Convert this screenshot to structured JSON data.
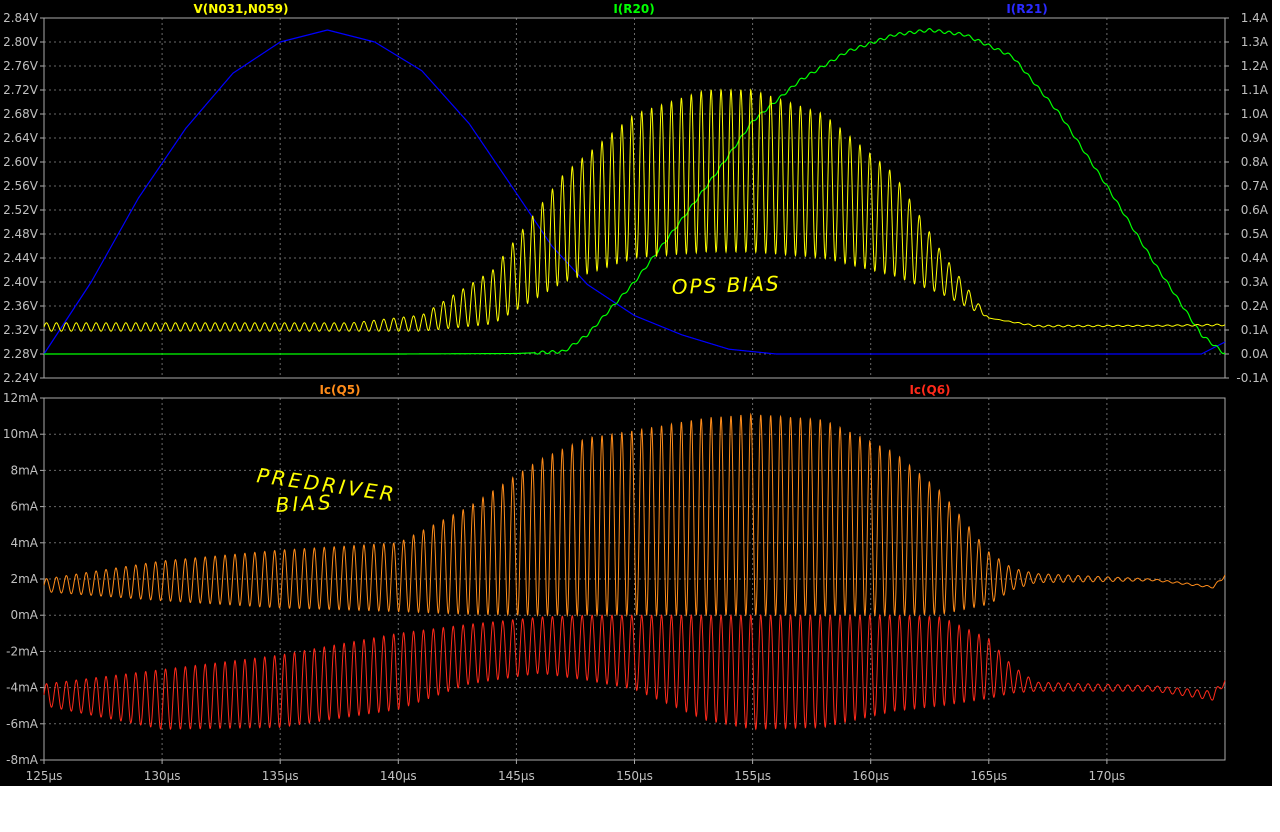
{
  "chart_data": [
    {
      "type": "line",
      "panel": "top",
      "x_unit": "µs",
      "xlim": [
        125,
        175
      ],
      "x_ticks": [
        "125µs",
        "130µs",
        "135µs",
        "140µs",
        "145µs",
        "150µs",
        "155µs",
        "160µs",
        "165µs",
        "170µs"
      ],
      "ylim_left": [
        2.24,
        2.84
      ],
      "left_ticks": [
        "2.84V",
        "2.80V",
        "2.76V",
        "2.72V",
        "2.68V",
        "2.64V",
        "2.60V",
        "2.56V",
        "2.52V",
        "2.48V",
        "2.44V",
        "2.40V",
        "2.36V",
        "2.32V",
        "2.28V",
        "2.24V"
      ],
      "ylim_right": [
        -0.1,
        1.4
      ],
      "right_ticks": [
        "1.4A",
        "1.3A",
        "1.2A",
        "1.1A",
        "1.0A",
        "0.9A",
        "0.8A",
        "0.7A",
        "0.6A",
        "0.5A",
        "0.4A",
        "0.3A",
        "0.2A",
        "0.1A",
        "0.0A",
        "-0.1A"
      ],
      "grid": true,
      "series": [
        {
          "name": "V(N031,N059)",
          "axis": "left",
          "color": "#ffff00",
          "ripple_period_us": 0.42,
          "envelope_max": {
            "x": [
              125,
              138,
              141,
              144,
              147,
              150,
              153,
              155,
              158,
              161,
              163,
              165,
              167,
              172,
              175
            ],
            "y": [
              2.332,
              2.332,
              2.345,
              2.42,
              2.58,
              2.68,
              2.72,
              2.72,
              2.68,
              2.58,
              2.45,
              2.34,
              2.328,
              2.328,
              2.33
            ]
          },
          "envelope_min": {
            "x": [
              125,
              138,
              141,
              144,
              147,
              150,
              153,
              155,
              158,
              161,
              163,
              165,
              167,
              172,
              175
            ],
            "y": [
              2.318,
              2.318,
              2.318,
              2.33,
              2.4,
              2.44,
              2.45,
              2.45,
              2.44,
              2.41,
              2.38,
              2.34,
              2.325,
              2.326,
              2.327
            ]
          }
        },
        {
          "name": "I(R20)",
          "axis": "right",
          "color": "#00ff00",
          "ripple_period_us": 0.42,
          "points": {
            "x": [
              125,
              140,
              145,
              147,
              148,
              150,
              152,
              153.5,
              155,
              157,
              159,
              161,
              162.5,
              164,
              166,
              168,
              170,
              172,
              174,
              175
            ],
            "y": [
              0.0,
              0.0,
              0.002,
              0.01,
              0.08,
              0.3,
              0.56,
              0.76,
              0.97,
              1.14,
              1.26,
              1.33,
              1.35,
              1.33,
              1.24,
              1.0,
              0.7,
              0.38,
              0.08,
              0.0
            ]
          }
        },
        {
          "name": "I(R21)",
          "axis": "right",
          "color": "#0000ff",
          "points": {
            "x": [
              125,
              127,
              129,
              131,
              133,
              135,
              137,
              139,
              141,
              143,
              145,
              146.5,
              148,
              150,
              152,
              154,
              156,
              160,
              165,
              170,
              174,
              175
            ],
            "y": [
              0.0,
              0.3,
              0.65,
              0.94,
              1.17,
              1.3,
              1.35,
              1.3,
              1.18,
              0.96,
              0.67,
              0.45,
              0.29,
              0.16,
              0.08,
              0.02,
              0.0,
              0.0,
              0.0,
              0.0,
              0.0,
              0.05
            ]
          }
        }
      ],
      "annotation": "OPS BIAS"
    },
    {
      "type": "line",
      "panel": "bottom",
      "x_unit": "µs",
      "xlim": [
        125,
        175
      ],
      "x_ticks": [
        "125µs",
        "130µs",
        "135µs",
        "140µs",
        "145µs",
        "150µs",
        "155µs",
        "160µs",
        "165µs",
        "170µs"
      ],
      "ylim": [
        -8,
        12
      ],
      "y_ticks": [
        "12mA",
        "10mA",
        "8mA",
        "6mA",
        "4mA",
        "2mA",
        "0mA",
        "-2mA",
        "-4mA",
        "-6mA",
        "-8mA"
      ],
      "grid": true,
      "series": [
        {
          "name": "Ic(Q5)",
          "color": "#ff8c1a",
          "ripple_period_us": 0.42,
          "envelope_max": {
            "x": [
              125,
              130,
              135,
              140,
              143,
              146,
              148,
              150,
              153,
              155,
              158,
              161,
              163,
              165,
              166,
              167,
              172,
              174.5,
              175
            ],
            "y": [
              2.0,
              3.0,
              3.6,
              4.0,
              6.0,
              8.6,
              9.8,
              10.2,
              10.9,
              11.1,
              10.8,
              9.0,
              6.8,
              3.5,
              2.6,
              2.3,
              2.0,
              1.6,
              2.3
            ]
          },
          "envelope_min": {
            "x": [
              125,
              130,
              135,
              140,
              143,
              146,
              148,
              150,
              153,
              155,
              158,
              161,
              163,
              165,
              166,
              167,
              172,
              174.5,
              175
            ],
            "y": [
              1.3,
              0.8,
              0.4,
              0.2,
              0.05,
              0.0,
              0.0,
              0.0,
              0.0,
              0.0,
              0.0,
              0.0,
              0.05,
              0.6,
              1.4,
              1.8,
              1.9,
              1.5,
              2.1
            ]
          }
        },
        {
          "name": "Ic(Q6)",
          "color": "#ff2a1a",
          "ripple_period_us": 0.42,
          "envelope_max": {
            "x": [
              125,
              130,
              135,
              140,
              143,
              146,
              148,
              150,
              153,
              155,
              158,
              161,
              163,
              165,
              166,
              167,
              172,
              174.5,
              175
            ],
            "y": [
              -3.8,
              -3.0,
              -2.2,
              -1.0,
              -0.5,
              -0.1,
              0.0,
              0.0,
              0.0,
              0.0,
              0.0,
              0.0,
              -0.1,
              -1.3,
              -2.8,
              -3.7,
              -3.9,
              -4.2,
              -3.5
            ]
          },
          "envelope_min": {
            "x": [
              125,
              130,
              135,
              140,
              143,
              146,
              148,
              150,
              153,
              155,
              158,
              161,
              163,
              165,
              166,
              167,
              172,
              174.5,
              175
            ],
            "y": [
              -5.0,
              -6.3,
              -6.2,
              -5.2,
              -3.8,
              -3.2,
              -3.6,
              -4.1,
              -5.8,
              -6.3,
              -6.2,
              -5.3,
              -5.0,
              -4.6,
              -4.3,
              -4.2,
              -4.2,
              -4.7,
              -3.8
            ]
          }
        }
      ],
      "annotation": [
        "PREDRIVER",
        "BIAS"
      ]
    }
  ]
}
